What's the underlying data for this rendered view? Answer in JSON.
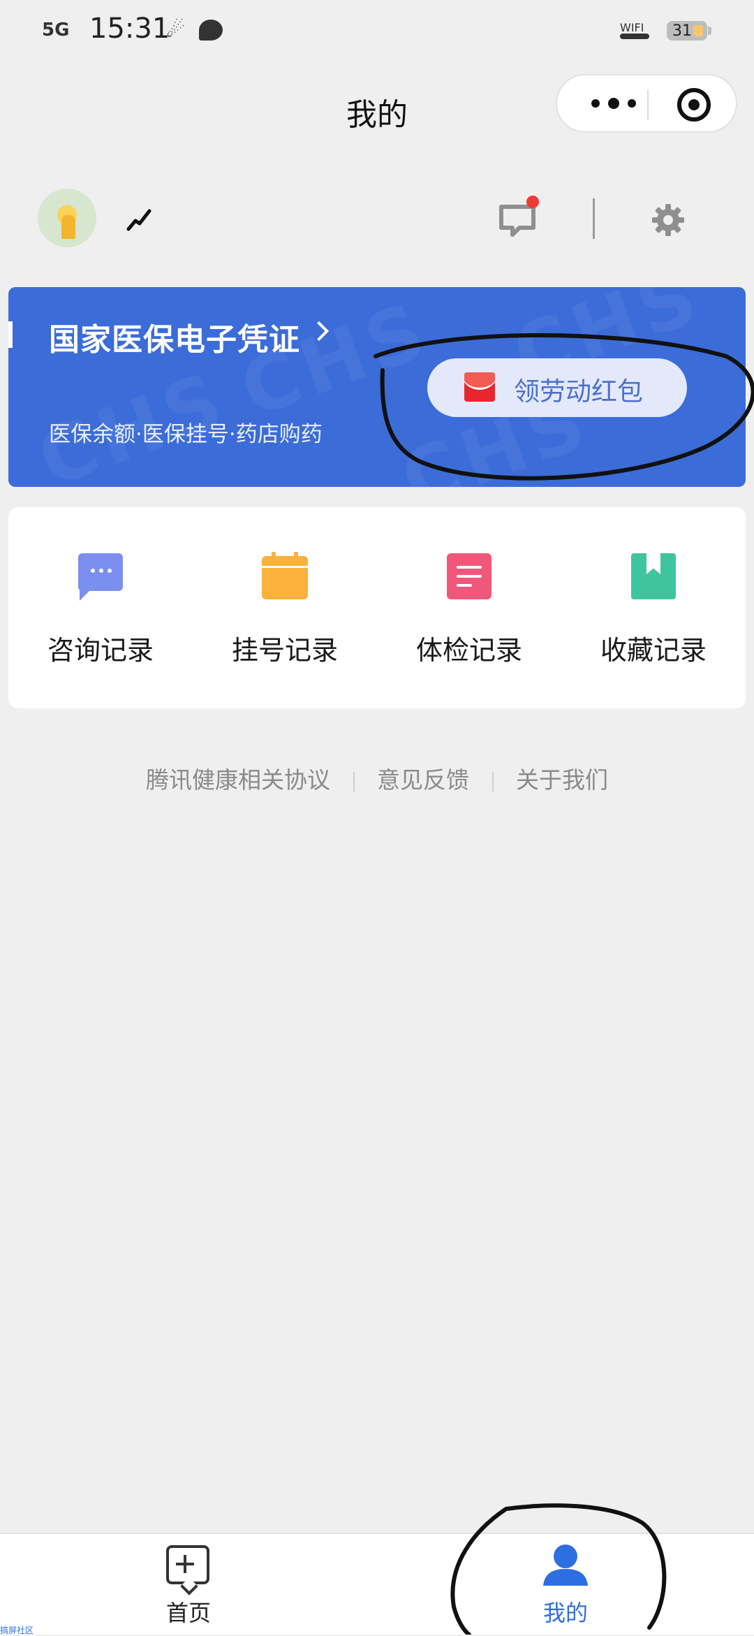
{
  "status_bar": {
    "signal": "5G",
    "time": "15:31",
    "wifi": "WIFI",
    "battery": "31"
  },
  "nav": {
    "title": "我的"
  },
  "insurance_card": {
    "title": "国家医保电子凭证",
    "subtitle": "医保余额·医保挂号·药店购药",
    "redpack_label": "领劳动红包",
    "watermark": "CHS"
  },
  "records": [
    {
      "label": "咨询记录",
      "icon": "chat-bubble-icon",
      "color": "#7b8ff0"
    },
    {
      "label": "挂号记录",
      "icon": "calendar-icon",
      "color": "#fbb13c"
    },
    {
      "label": "体检记录",
      "icon": "document-icon",
      "color": "#f1577a"
    },
    {
      "label": "收藏记录",
      "icon": "bookmark-icon",
      "color": "#3fc4a0"
    }
  ],
  "footer_links": [
    "腾讯健康相关协议",
    "意见反馈",
    "关于我们"
  ],
  "tabbar": {
    "home_label": "首页",
    "me_label": "我的",
    "active_color": "#2d6fe0"
  },
  "corner_tag": "搞屏社区",
  "colors": {
    "card_blue": "#3b6cd8",
    "background": "#efefef"
  }
}
